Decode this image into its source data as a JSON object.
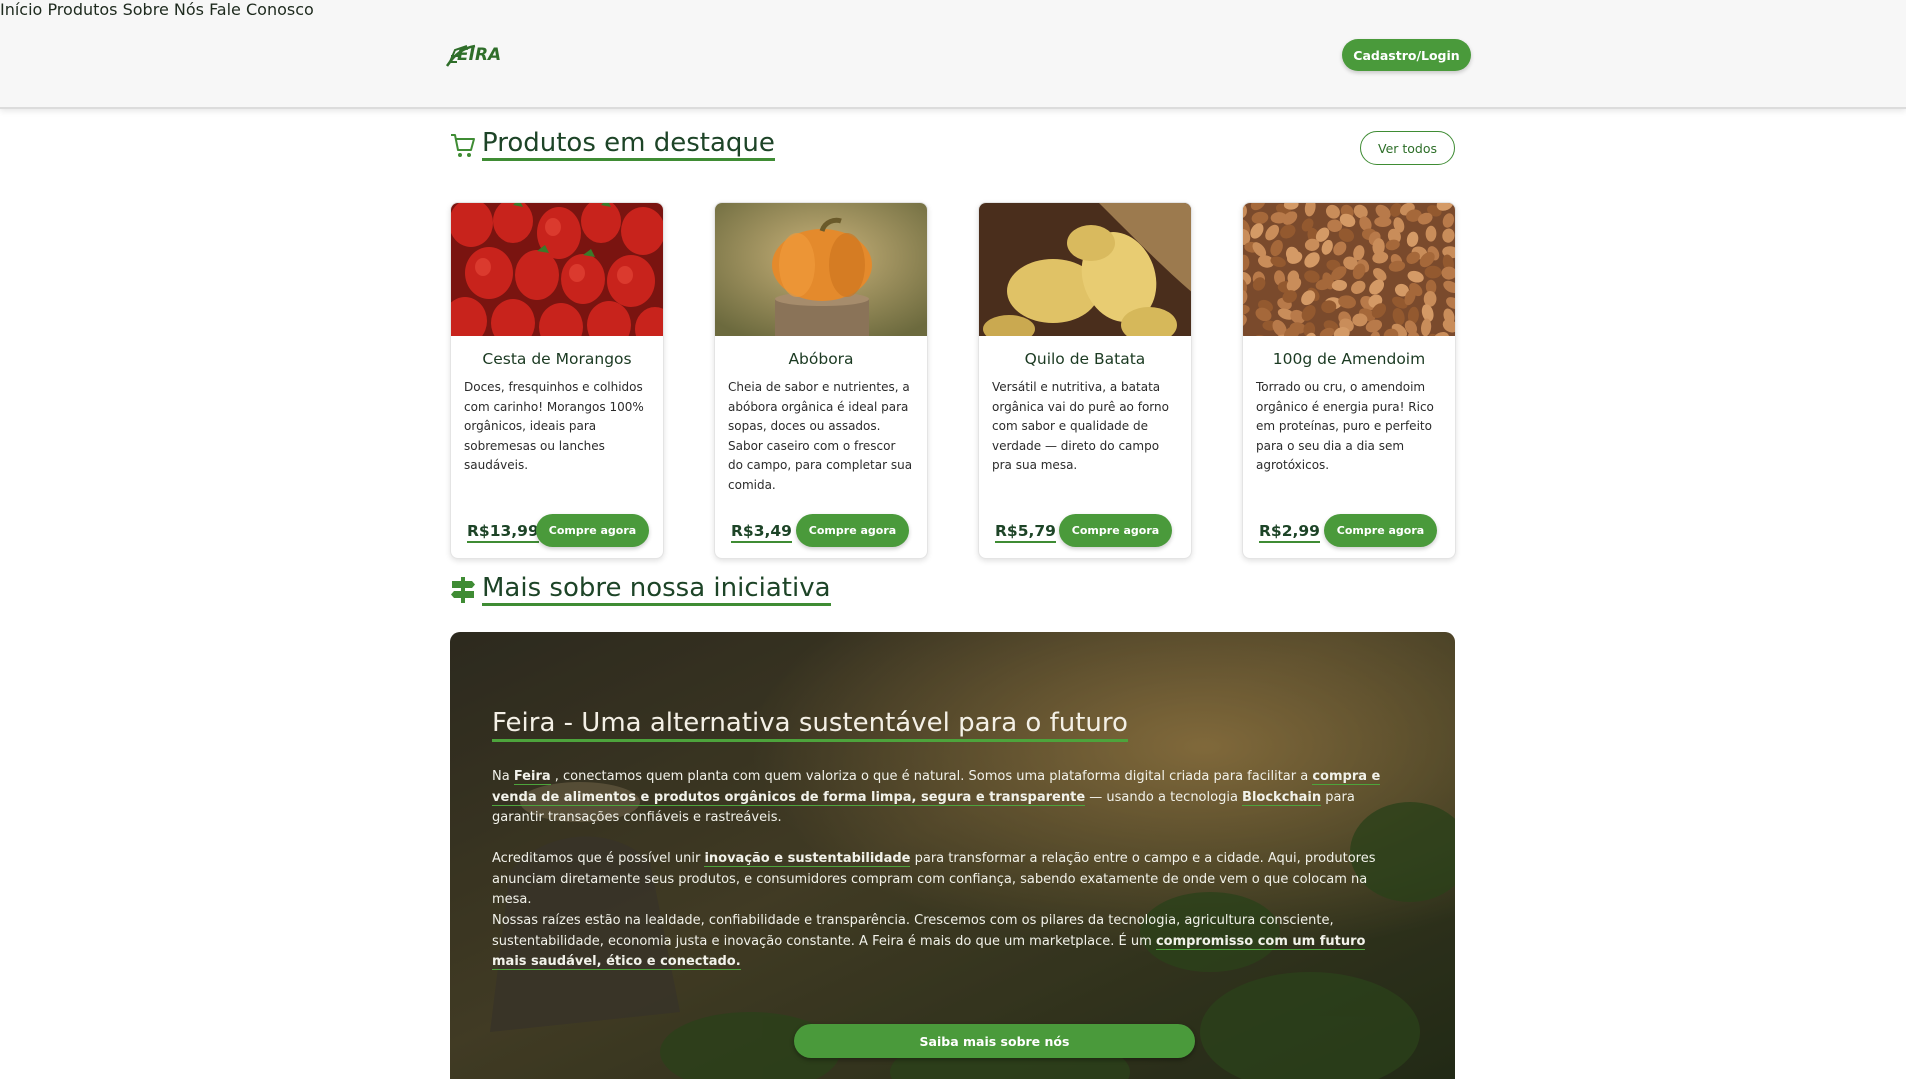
{
  "header": {
    "nav": [
      {
        "label": "Início",
        "active": true
      },
      {
        "label": "Produtos",
        "active": false
      },
      {
        "label": "Sobre Nós",
        "active": false
      },
      {
        "label": "Fale Conosco",
        "active": false
      }
    ],
    "login_label": "Cadastro/Login"
  },
  "featured": {
    "title": "Produtos em destaque",
    "see_all_label": "Ver todos",
    "products": [
      {
        "name": "Cesta de Morangos",
        "description": "Doces, fresquinhos e colhidos com carinho! Morangos 100% orgânicos, ideais para sobremesas ou lanches saudáveis.",
        "price": "R$13,99",
        "buy_label": "Compre agora",
        "image": "strawberries"
      },
      {
        "name": "Abóbora",
        "description": "Cheia de sabor e nutrientes, a abóbora orgânica é ideal para sopas, doces ou assados. Sabor caseiro com o frescor do campo, para completar sua comida.",
        "price": "R$3,49",
        "buy_label": "Compre agora",
        "image": "pumpkin"
      },
      {
        "name": "Quilo de Batata",
        "description": "Versátil e nutritiva, a batata orgânica vai do purê ao forno com sabor e qualidade de verdade — direto do campo pra sua mesa.",
        "price": "R$5,79",
        "buy_label": "Compre agora",
        "image": "potatoes"
      },
      {
        "name": "100g de Amendoim",
        "description": "Torrado ou cru, o amendoim orgânico é energia pura! Rico em proteínas, puro e perfeito para o seu dia a dia sem agrotóxicos.",
        "price": "R$2,99",
        "buy_label": "Compre agora",
        "image": "peanuts"
      }
    ]
  },
  "initiative": {
    "title": "Mais sobre nossa iniciativa",
    "banner_title": "Feira - Uma alternativa sustentável para o futuro",
    "p1": {
      "a": "Na ",
      "b1": "Feira",
      "c": " , conectamos quem planta com quem valoriza o que é natural. Somos uma plataforma digital criada para facilitar a ",
      "b2": "compra e venda de alimentos e produtos orgânicos de forma limpa, segura e transparente",
      "d": " — usando a tecnologia ",
      "b3": "Blockchain",
      "e": " para garantir transações confiáveis e rastreáveis."
    },
    "p2": {
      "a": "Acreditamos que é possível unir ",
      "b1": "inovação e sustentabilidade",
      "c": " para transformar a relação entre o campo e a cidade. Aqui, produtores anunciam diretamente seus produtos, e consumidores compram com confiança, sabendo exatamente de onde vem o que colocam na mesa."
    },
    "p3": {
      "a": "Nossas raízes estão na lealdade, confiabilidade e transparência. Crescemos com os pilares da tecnologia, agricultura consciente, sustentabilidade, economia justa e inovação constante. A Feira é mais do que um marketplace. É um ",
      "b1": "compromisso com um futuro mais saudável, ético e conectado."
    },
    "button_label": "Saiba mais sobre nós"
  },
  "colors": {
    "accent": "#4a9a3b",
    "title": "#1d4427"
  }
}
